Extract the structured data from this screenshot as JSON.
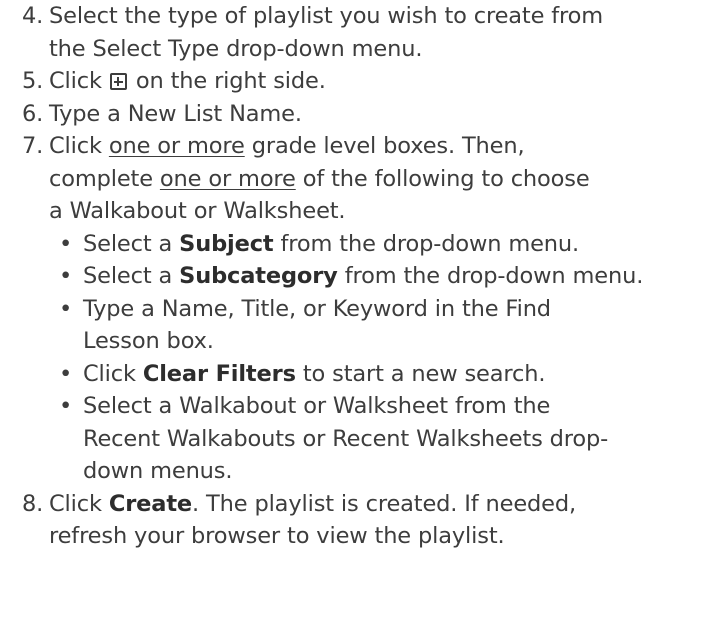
{
  "step4": {
    "num": "4.",
    "line1": "Select the type of playlist you wish to create from",
    "line2": "the Select Type drop-down menu."
  },
  "step5": {
    "num": "5.",
    "before_icon": "Click ",
    "after_icon": " on the right side."
  },
  "step6": {
    "num": "6.",
    "text": "Type a New List Name."
  },
  "step7": {
    "num": "7.",
    "line1_a": "Click ",
    "line1_u": "one or more",
    "line1_b": " grade level boxes. Then,",
    "line2_a": "complete ",
    "line2_u": "one or more",
    "line2_b": " of the following to choose",
    "line3": "a Walkabout or Walksheet.",
    "bullet_char": "•",
    "bullets": {
      "subject": {
        "pre": "Select a ",
        "bold": "Subject",
        "post": " from the drop-down menu."
      },
      "subcategory": {
        "pre": "Select a ",
        "bold": "Subcategory",
        "post": " from the drop-down menu."
      },
      "find": {
        "line1": "Type a Name, Title, or Keyword in the Find",
        "line2": "Lesson box."
      },
      "clear": {
        "pre": "Click ",
        "bold": "Clear Filters",
        "post": " to start a new search."
      },
      "recent": {
        "line1": "Select a Walkabout or Walksheet from the",
        "line2": "Recent Walkabouts or Recent Walksheets drop-",
        "line3": "down menus."
      }
    }
  },
  "step8": {
    "num": "8.",
    "pre": "Click ",
    "bold": "Create",
    "line1_post": ". The playlist is created. If needed,",
    "line2": "refresh your browser to view the playlist."
  },
  "icons": {
    "add": "plus-square-icon"
  }
}
